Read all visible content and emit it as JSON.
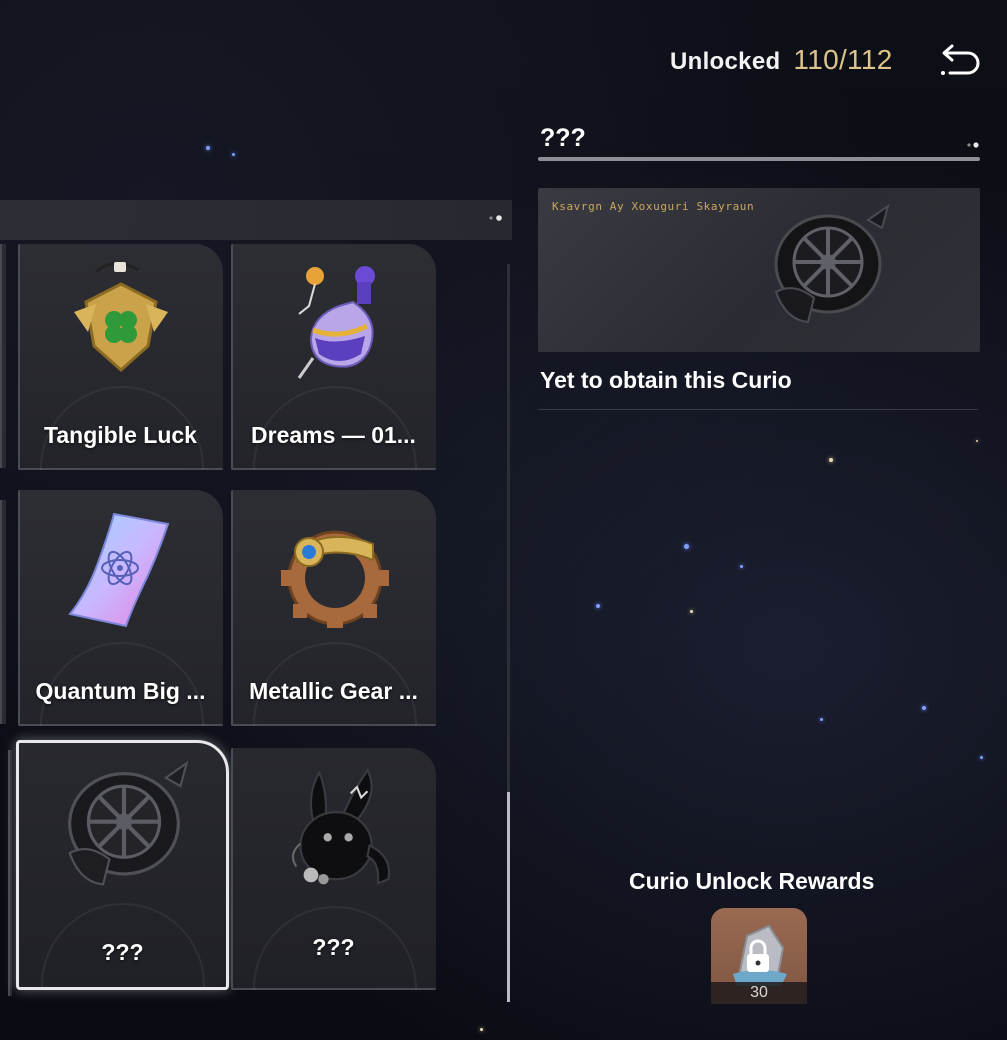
{
  "header": {
    "unlocked_label": "Unlocked",
    "unlocked_count": "110/112",
    "back_icon": "return-arrow-icon"
  },
  "detail": {
    "title": "???",
    "image_caption_runes": "Ksavrgn Ay Xoxuguri Skayraun",
    "status_text": "Yet to obtain this Curio"
  },
  "rewards": {
    "title": "Curio Unlock Rewards",
    "item_icon": "locked-crystal-icon",
    "item_quantity": "30"
  },
  "curios": [
    {
      "name": "Tangible Luck",
      "icon": "clover-amulet-icon",
      "locked": false,
      "selected": false
    },
    {
      "name": "Dreams — 01...",
      "icon": "potion-flask-icon",
      "locked": false,
      "selected": false
    },
    {
      "name": "Quantum Big ...",
      "icon": "ticket-icon",
      "locked": false,
      "selected": false
    },
    {
      "name": "Metallic Gear ...",
      "icon": "gear-ring-icon",
      "locked": false,
      "selected": false
    },
    {
      "name": "???",
      "icon": "fish-wheel-icon",
      "locked": true,
      "selected": true
    },
    {
      "name": "???",
      "icon": "rabbit-icon",
      "locked": true,
      "selected": false
    }
  ],
  "colors": {
    "accent_gold": "#dcc48a",
    "panel_bg": "#2d2e34",
    "selected_border": "#e8e8ea"
  }
}
